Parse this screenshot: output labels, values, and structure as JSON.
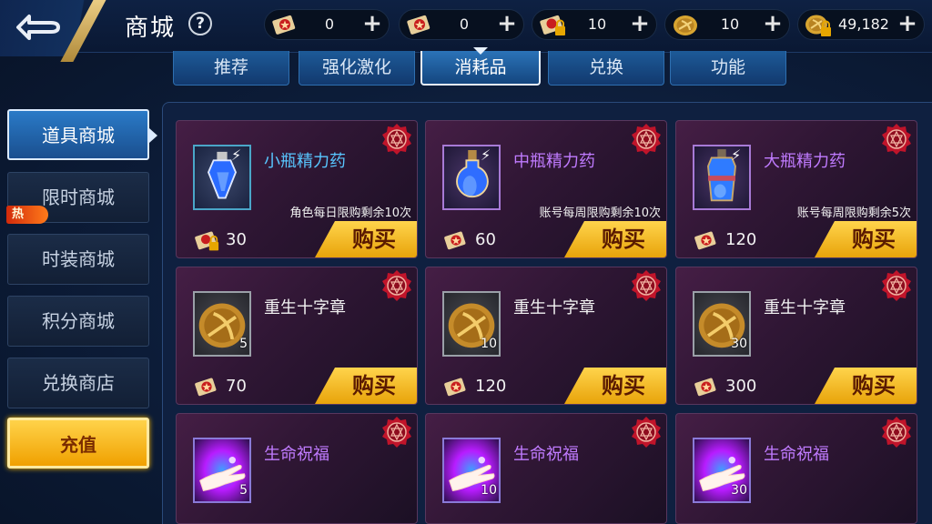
{
  "header": {
    "title": "商城",
    "help": "?",
    "resources": [
      {
        "icon": "red-scroll-icon",
        "value": "0"
      },
      {
        "icon": "red-scroll-icon",
        "value": "0"
      },
      {
        "icon": "locked-scroll-icon",
        "value": "10"
      },
      {
        "icon": "gold-coin-icon",
        "value": "10"
      },
      {
        "icon": "locked-gold-coin-icon",
        "value": "49,182"
      }
    ]
  },
  "tabs": [
    {
      "label": "推荐"
    },
    {
      "label": "强化激化"
    },
    {
      "label": "消耗品",
      "active": true
    },
    {
      "label": "兑换"
    },
    {
      "label": "功能"
    }
  ],
  "sidebar": {
    "items": [
      {
        "label": "道具商城",
        "active": true
      },
      {
        "label": "限时商城",
        "badge": "热"
      },
      {
        "label": "时装商城"
      },
      {
        "label": "积分商城"
      },
      {
        "label": "兑换商店"
      }
    ],
    "recharge": "充值"
  },
  "items": [
    {
      "name": "小瓶精力药",
      "color": "#58c6ff",
      "icon": "small-potion-icon",
      "limit": "角色每日限购剩余10次",
      "cost_icon": "locked-scroll-icon",
      "cost": "30",
      "buy": "购买"
    },
    {
      "name": "中瓶精力药",
      "color": "#c07bff",
      "icon": "medium-potion-icon",
      "limit": "账号每周限购剩余10次",
      "cost_icon": "red-scroll-icon",
      "cost": "60",
      "buy": "购买"
    },
    {
      "name": "大瓶精力药",
      "color": "#c07bff",
      "icon": "large-potion-icon",
      "limit": "账号每周限购剩余5次",
      "cost_icon": "red-scroll-icon",
      "cost": "120",
      "buy": "购买"
    },
    {
      "name": "重生十字章",
      "icon": "rebirth-cross-coin-icon",
      "qty": "5",
      "cost_icon": "red-scroll-icon",
      "cost": "70",
      "buy": "购买"
    },
    {
      "name": "重生十字章",
      "icon": "rebirth-cross-coin-icon",
      "qty": "10",
      "cost_icon": "red-scroll-icon",
      "cost": "120",
      "buy": "购买"
    },
    {
      "name": "重生十字章",
      "icon": "rebirth-cross-coin-icon",
      "qty": "30",
      "cost_icon": "red-scroll-icon",
      "cost": "300",
      "buy": "购买"
    },
    {
      "name": "生命祝福",
      "color": "#c07bff",
      "icon": "life-blessing-hand-icon",
      "qty": "5"
    },
    {
      "name": "生命祝福",
      "color": "#c07bff",
      "icon": "life-blessing-hand-icon",
      "qty": "10"
    },
    {
      "name": "生命祝福",
      "color": "#c07bff",
      "icon": "life-blessing-hand-icon",
      "qty": "30"
    }
  ]
}
